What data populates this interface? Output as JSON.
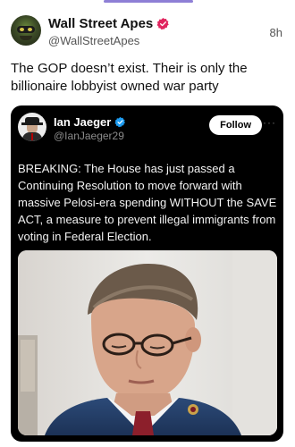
{
  "post": {
    "author": {
      "display_name": "Wall Street Apes",
      "handle": "@WallStreetApes",
      "verified_icon": "verified-badge-icon",
      "verified_color": "#e0245e"
    },
    "timestamp": "8h",
    "text": "The GOP doesn’t exist. Their is only the billionaire lobbyist owned war party"
  },
  "quoted_post": {
    "author": {
      "display_name": "Ian Jaeger",
      "handle": "@IanJaeger29",
      "verified_icon": "verified-badge-icon",
      "verified_color": "#1d9bf0"
    },
    "follow_label": "Follow",
    "more_label": "···",
    "text": "BREAKING: The House has just passed a Continuing Resolution to move forward with massive Pelosi-era spending WITHOUT the SAVE ACT, a measure to prevent illegal immigrants from voting in Federal Election.",
    "media": {
      "icon": "photo"
    }
  },
  "colors": {
    "accent_indicator": "#8e7fd6",
    "quote_background": "#000000"
  }
}
